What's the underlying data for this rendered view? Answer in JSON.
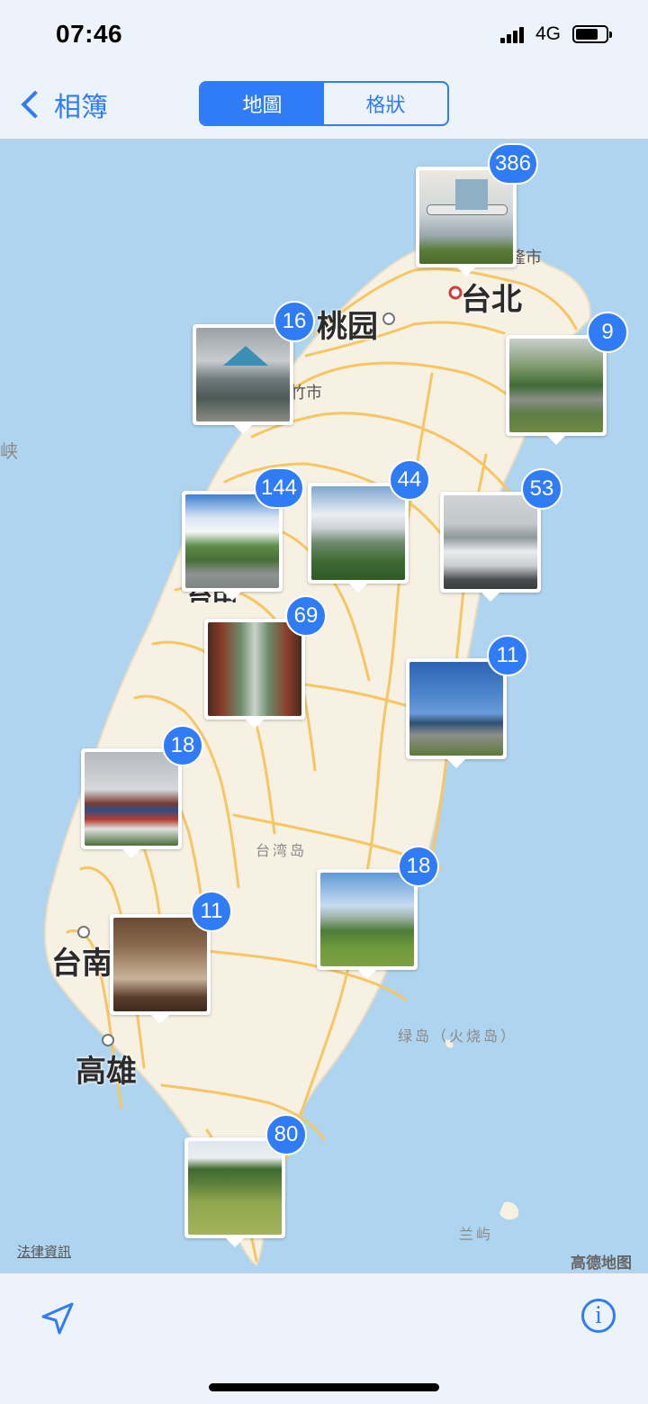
{
  "status": {
    "time": "07:46",
    "network": "4G"
  },
  "nav": {
    "back_label": "相簿",
    "segments": [
      "地圖",
      "格狀"
    ],
    "active_segment": 0
  },
  "map": {
    "cities": [
      "台北",
      "桃园",
      "台南",
      "高雄"
    ],
    "labels": {
      "keelung": "隆市",
      "hsinchu": "竹市",
      "island": "台湾岛",
      "ludao": "绿岛（火烧岛）",
      "lanyu": "兰屿",
      "strait": "峡",
      "taichung": "台中"
    },
    "clusters": [
      {
        "count": "386",
        "photo": "airplane-model"
      },
      {
        "count": "16",
        "photo": "visitor-center"
      },
      {
        "count": "9",
        "photo": "coastal-market"
      },
      {
        "count": "144",
        "photo": "mountain-clouds"
      },
      {
        "count": "44",
        "photo": "mountain-valley"
      },
      {
        "count": "53",
        "photo": "sea-waves"
      },
      {
        "count": "69",
        "photo": "suspension-bridge"
      },
      {
        "count": "11",
        "photo": "coastal-rocks"
      },
      {
        "count": "18",
        "photo": "temple"
      },
      {
        "count": "18",
        "photo": "grassland-pavilion"
      },
      {
        "count": "11",
        "photo": "bathroom"
      },
      {
        "count": "80",
        "photo": "cows-pasture"
      }
    ],
    "legal_link": "法律資訊",
    "provider": "高德地图"
  },
  "toolbar": {
    "location_icon": "location-arrow-icon",
    "info_icon": "info-icon"
  },
  "colors": {
    "accent": "#2f7cf6",
    "sea": "#aed4ef",
    "land": "#f7f1e4",
    "road": "#f6c663"
  }
}
